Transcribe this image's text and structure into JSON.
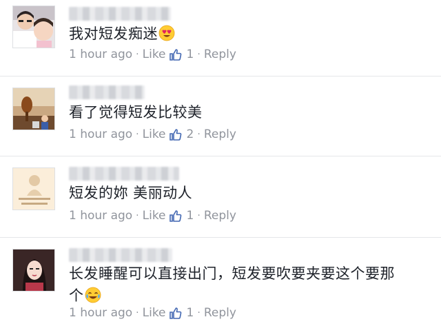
{
  "comments": [
    {
      "text": "我对短发痴迷",
      "emoji": "heart-eyes-emoji",
      "time": "1 hour ago",
      "like_label": "Like",
      "like_count": "1",
      "reply_label": "Reply"
    },
    {
      "text": "看了觉得短发比较美",
      "time": "1 hour ago",
      "like_label": "Like",
      "like_count": "2",
      "reply_label": "Reply"
    },
    {
      "text": "短发的妳 美丽动人",
      "time": "1 hour ago",
      "like_label": "Like",
      "like_count": "1",
      "reply_label": "Reply"
    },
    {
      "text_line1": "长发睡醒可以直接出门，短发要吹要夹要这个要那",
      "text_line2": "个",
      "emoji": "tears-of-joy-emoji",
      "time": "1 hour ago",
      "like_label": "Like",
      "like_count": "1",
      "reply_label": "Reply"
    }
  ],
  "colors": {
    "text": "#1d2129",
    "meta": "#90949c",
    "like_icon": "#4267b2",
    "divider": "#e5e6e9"
  }
}
